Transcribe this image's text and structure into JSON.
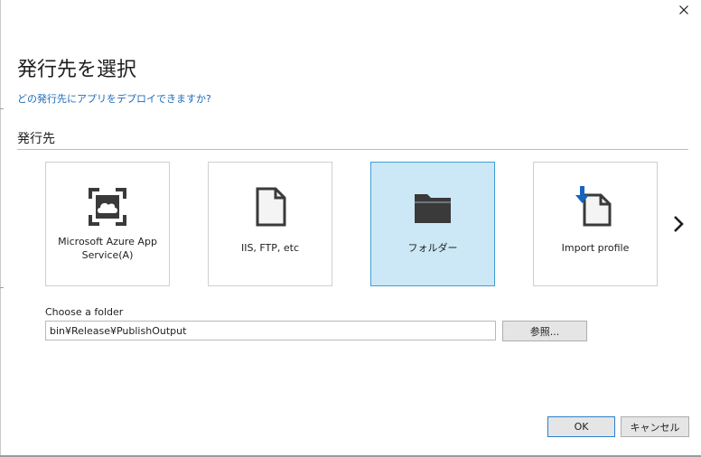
{
  "dialog": {
    "title": "発行先を選択",
    "help_link": "どの発行先にアプリをデプロイできますか?",
    "close_icon": "close-icon"
  },
  "targets": {
    "section_label": "発行先",
    "items": [
      {
        "label": "Microsoft Azure App Service(A)",
        "icon": "azure-app-service-icon",
        "selected": false
      },
      {
        "label": "IIS, FTP, etc",
        "icon": "document-icon",
        "selected": false
      },
      {
        "label": "フォルダー",
        "icon": "folder-icon",
        "selected": true
      },
      {
        "label": "Import profile",
        "icon": "import-profile-icon",
        "selected": false
      }
    ],
    "next_icon": "chevron-right-icon"
  },
  "folder": {
    "label": "Choose a folder",
    "value": "bin¥Release¥PublishOutput",
    "browse_label": "参照..."
  },
  "footer": {
    "ok_label": "OK",
    "cancel_label": "キャンセル"
  },
  "colors": {
    "accent_link": "#1e6bb8",
    "selected_card_bg": "#cce8f6",
    "selected_card_border": "#3f9fd6",
    "icon_dark": "#3a3a3a",
    "import_arrow": "#1565c0"
  }
}
